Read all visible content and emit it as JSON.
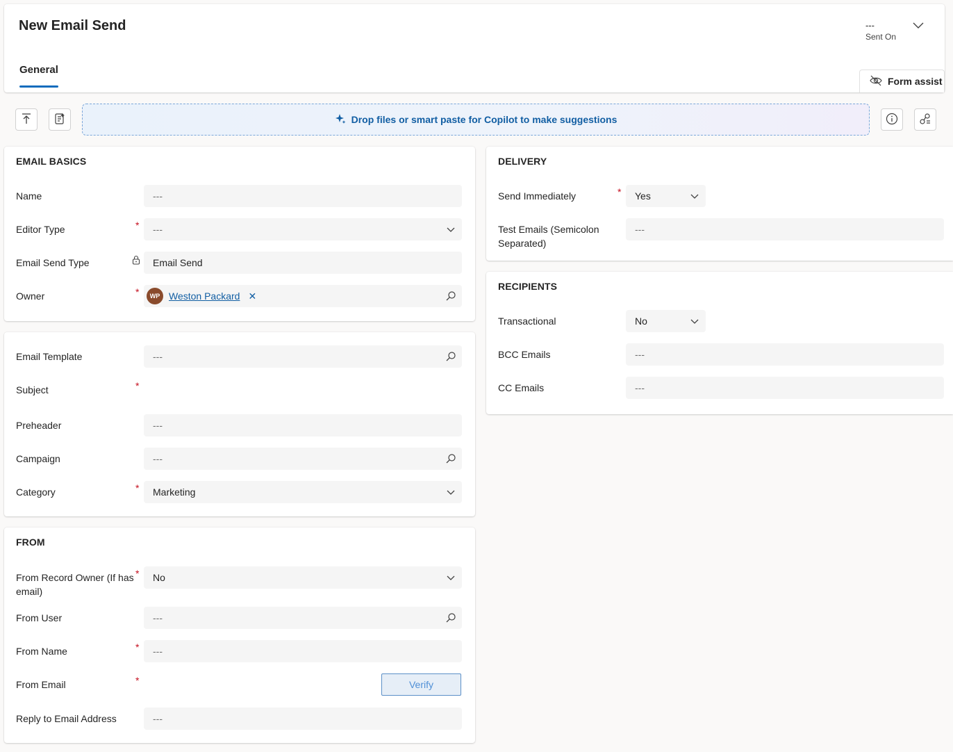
{
  "header": {
    "title": "New Email Send",
    "sent_on_value": "---",
    "sent_on_label": "Sent On",
    "tab_general": "General",
    "form_assist": "Form assist"
  },
  "copilot": {
    "drop_text": "Drop files or smart paste for Copilot to make suggestions"
  },
  "email_basics": {
    "title": "EMAIL BASICS",
    "name_label": "Name",
    "name_value": "---",
    "editor_type_label": "Editor Type",
    "editor_type_value": "---",
    "email_send_type_label": "Email Send Type",
    "email_send_type_value": "Email Send",
    "owner_label": "Owner",
    "owner_initials": "WP",
    "owner_name": "Weston Packard"
  },
  "content": {
    "email_template_label": "Email Template",
    "email_template_value": "---",
    "subject_label": "Subject",
    "preheader_label": "Preheader",
    "preheader_value": "---",
    "campaign_label": "Campaign",
    "campaign_value": "---",
    "category_label": "Category",
    "category_value": "Marketing"
  },
  "from": {
    "title": "FROM",
    "from_record_owner_label": "From Record Owner (If has email)",
    "from_record_owner_value": "No",
    "from_user_label": "From User",
    "from_user_value": "---",
    "from_name_label": "From Name",
    "from_name_value": "---",
    "from_email_label": "From Email",
    "verify_label": "Verify",
    "reply_to_label": "Reply to Email Address",
    "reply_to_value": "---"
  },
  "delivery": {
    "title": "DELIVERY",
    "send_immediately_label": "Send Immediately",
    "send_immediately_value": "Yes",
    "test_emails_label": "Test Emails (Semicolon Separated)",
    "test_emails_value": "---"
  },
  "recipients": {
    "title": "RECIPIENTS",
    "transactional_label": "Transactional",
    "transactional_value": "No",
    "bcc_label": "BCC Emails",
    "bcc_value": "---",
    "cc_label": "CC Emails",
    "cc_value": "---"
  },
  "colors": {
    "accent": "#0f6cbd",
    "required": "#c50f1f",
    "link": "#115ea3"
  },
  "icons": {
    "hdr_chevron": "chevron-down-icon",
    "form_assist": "eye-off-icon",
    "upload": "upload-icon",
    "notes": "notes-icon",
    "copilot": "sparkle-icon",
    "info": "info-icon",
    "share": "share-icon",
    "lookup": "search-icon",
    "dropdown": "chevron-down-icon",
    "lock": "lock-icon",
    "remove": "close-icon"
  }
}
